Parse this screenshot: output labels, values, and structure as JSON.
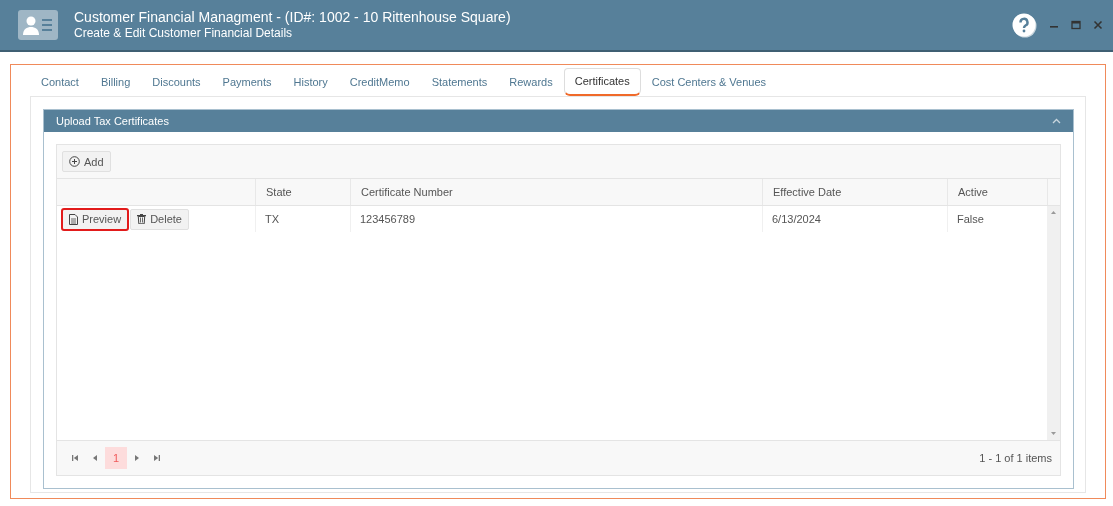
{
  "window": {
    "title": "Customer Financial Managment - (ID#: 1002 - 10 Rittenhouse Square)",
    "subtitle": "Create & Edit Customer Financial Details"
  },
  "tabs": [
    {
      "label": "Contact",
      "selected": false
    },
    {
      "label": "Billing",
      "selected": false
    },
    {
      "label": "Discounts",
      "selected": false
    },
    {
      "label": "Payments",
      "selected": false
    },
    {
      "label": "History",
      "selected": false
    },
    {
      "label": "CreditMemo",
      "selected": false
    },
    {
      "label": "Statements",
      "selected": false
    },
    {
      "label": "Rewards",
      "selected": false
    },
    {
      "label": "Certificates",
      "selected": true
    },
    {
      "label": "Cost Centers & Venues",
      "selected": false
    }
  ],
  "panel": {
    "title": "Upload Tax Certificates",
    "expanded": true
  },
  "toolbar": {
    "add_label": "Add"
  },
  "table": {
    "columns": [
      "State",
      "Certificate Number",
      "Effective Date",
      "Active"
    ],
    "rows": [
      {
        "actions": [
          {
            "kind": "preview",
            "label": "Preview",
            "highlighted": true
          },
          {
            "kind": "delete",
            "label": "Delete",
            "highlighted": false
          }
        ],
        "cells": [
          "TX",
          "123456789",
          "6/13/2024",
          "False"
        ]
      }
    ]
  },
  "pager": {
    "pages": [
      {
        "label": "1",
        "selected": true
      }
    ],
    "summary": "1 - 1 of 1 items"
  }
}
